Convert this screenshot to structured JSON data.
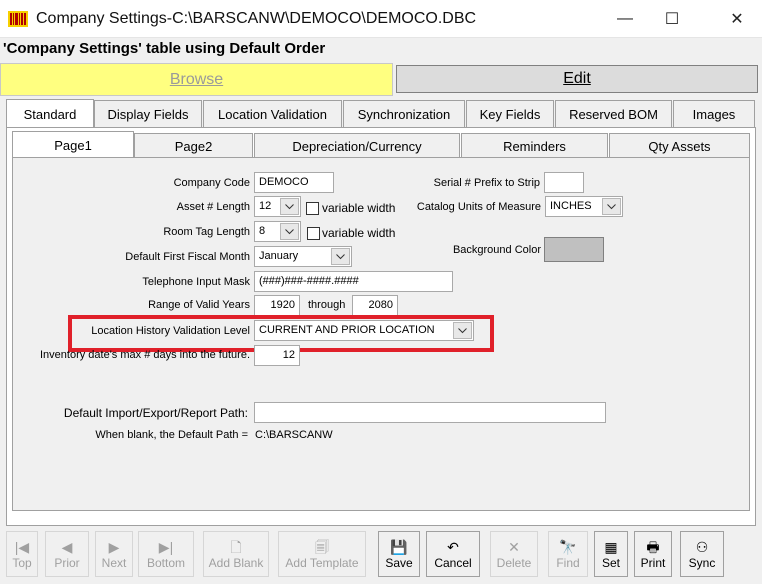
{
  "window": {
    "title": "Company Settings-C:\\BARSCANW\\DEMOCO\\DEMOCO.DBC",
    "minimize_glyph": "—",
    "maximize_glyph": "☐",
    "close_glyph": "✕"
  },
  "heading": "'Company Settings' table using Default Order",
  "mode": {
    "browse_label": "Browse",
    "edit_label": "Edit"
  },
  "tabs": [
    "Standard",
    "Display Fields",
    "Location Validation",
    "Synchronization",
    "Key Fields",
    "Reserved BOM",
    "Images"
  ],
  "subtabs": [
    "Page1",
    "Page2",
    "Depreciation/Currency",
    "Reminders",
    "Qty Assets"
  ],
  "form": {
    "company_code": {
      "label": "Company Code",
      "value": "DEMOCO"
    },
    "asset_length": {
      "label": "Asset # Length",
      "value": "12",
      "check_label": "variable width"
    },
    "room_tag_length": {
      "label": "Room Tag Length",
      "value": "8",
      "check_label": "variable width"
    },
    "fiscal_month": {
      "label": "Default First Fiscal Month",
      "value": "January"
    },
    "telephone_mask": {
      "label": "Telephone Input Mask",
      "value": "(###)###-####.####"
    },
    "valid_years": {
      "label": "Range of Valid Years",
      "from": "1920",
      "through_label": "through",
      "to": "2080"
    },
    "location_history": {
      "label": "Location History Validation Level",
      "value": "CURRENT AND PRIOR LOCATION"
    },
    "inventory_days": {
      "label": "Inventory date's max # days into the future.",
      "value": "12"
    },
    "serial_prefix": {
      "label": "Serial # Prefix to Strip",
      "value": ""
    },
    "catalog_units": {
      "label": "Catalog Units of Measure",
      "value": "INCHES"
    },
    "background_color": {
      "label": "Background Color",
      "swatch": "#c0c0c0"
    },
    "default_path": {
      "label": "Default Import/Export/Report Path:",
      "value": ""
    },
    "path_note": {
      "label": "When blank, the Default Path =",
      "value": "C:\\BARSCANW"
    }
  },
  "toolbar": [
    {
      "label": "Top",
      "icon": "|◀",
      "enabled": false
    },
    {
      "label": "Prior",
      "icon": "◀",
      "enabled": false
    },
    {
      "label": "Next",
      "icon": "▶",
      "enabled": false
    },
    {
      "label": "Bottom",
      "icon": "▶|",
      "enabled": false
    },
    {
      "label": "Add Blank",
      "icon": "🗋",
      "enabled": false
    },
    {
      "label": "Add Template",
      "icon": "🗐",
      "enabled": false
    },
    {
      "label": "Save",
      "icon": "💾",
      "enabled": true
    },
    {
      "label": "Cancel",
      "icon": "↶",
      "enabled": true
    },
    {
      "label": "Delete",
      "icon": "✕",
      "enabled": false
    },
    {
      "label": "Find",
      "icon": "🔭",
      "enabled": false
    },
    {
      "label": "Set",
      "icon": "▦",
      "enabled": true
    },
    {
      "label": "Print",
      "icon": "🖶",
      "enabled": true
    },
    {
      "label": "Sync",
      "icon": "⚇",
      "enabled": true
    }
  ],
  "colors": {
    "highlight": "#e0202a",
    "browse_bg": "#ffff80"
  }
}
